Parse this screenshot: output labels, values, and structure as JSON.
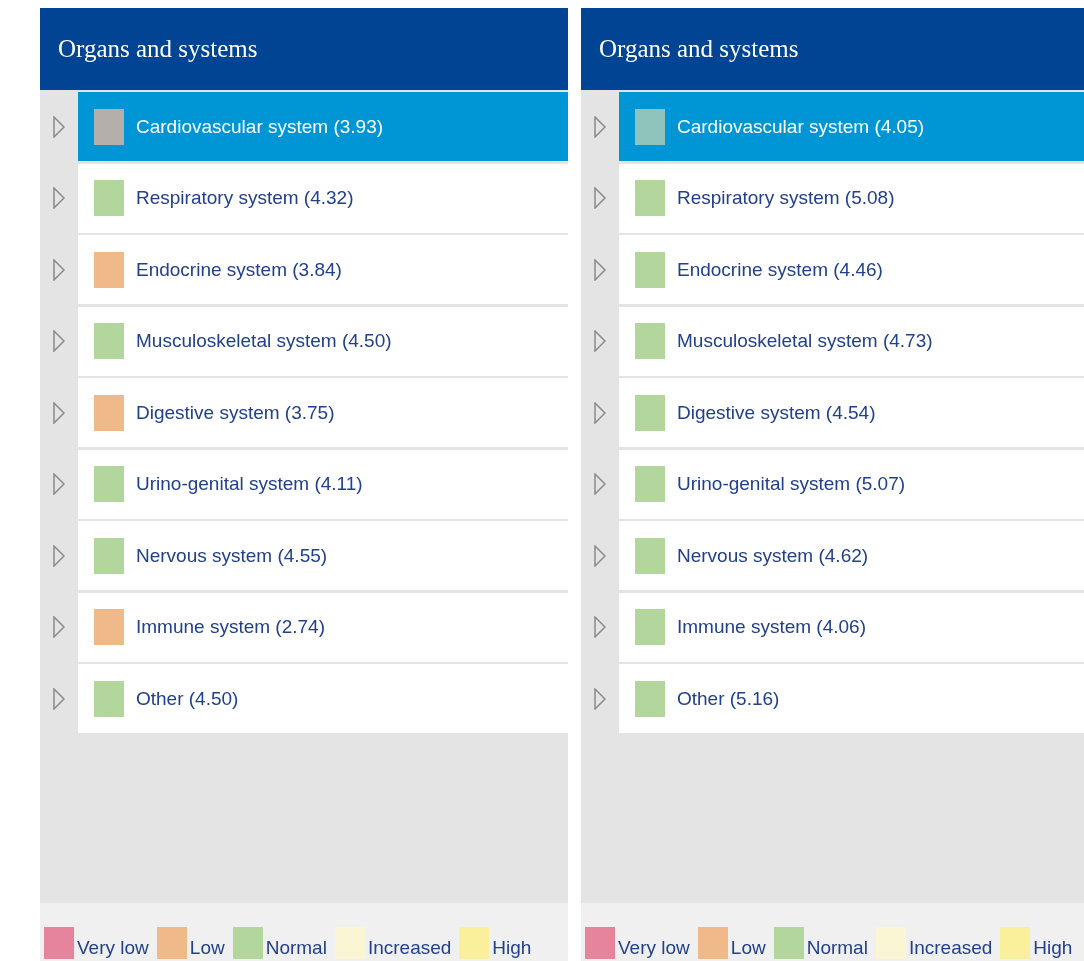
{
  "panels": [
    {
      "title": "Organs and systems",
      "items": [
        {
          "label": "Cardiovascular system (3.93)",
          "color": "#b5afab",
          "selected": true
        },
        {
          "label": "Respiratory system (4.32)",
          "color": "#b3d69d",
          "selected": false
        },
        {
          "label": "Endocrine system (3.84)",
          "color": "#f0b98a",
          "selected": false
        },
        {
          "label": "Musculoskeletal system (4.50)",
          "color": "#b3d69d",
          "selected": false
        },
        {
          "label": "Digestive system (3.75)",
          "color": "#f0b98a",
          "selected": false
        },
        {
          "label": "Urino-genital system (4.11)",
          "color": "#b3d69d",
          "selected": false
        },
        {
          "label": "Nervous system (4.55)",
          "color": "#b3d69d",
          "selected": false
        },
        {
          "label": "Immune system (2.74)",
          "color": "#f0b98a",
          "selected": false
        },
        {
          "label": "Other (4.50)",
          "color": "#b3d69d",
          "selected": false
        }
      ],
      "legend": [
        {
          "label": "Very low",
          "color": "#e6849c"
        },
        {
          "label": "Low",
          "color": "#f0b98a"
        },
        {
          "label": "Normal",
          "color": "#b3d69d"
        },
        {
          "label": "Increased",
          "color": "#faf5d3"
        },
        {
          "label": "High",
          "color": "#faf09c"
        }
      ]
    },
    {
      "title": "Organs and systems",
      "items": [
        {
          "label": "Cardiovascular system (4.05)",
          "color": "#8ec4bc",
          "selected": true
        },
        {
          "label": "Respiratory system (5.08)",
          "color": "#b3d69d",
          "selected": false
        },
        {
          "label": "Endocrine system (4.46)",
          "color": "#b3d69d",
          "selected": false
        },
        {
          "label": "Musculoskeletal system (4.73)",
          "color": "#b3d69d",
          "selected": false
        },
        {
          "label": "Digestive system (4.54)",
          "color": "#b3d69d",
          "selected": false
        },
        {
          "label": "Urino-genital system (5.07)",
          "color": "#b3d69d",
          "selected": false
        },
        {
          "label": "Nervous system (4.62)",
          "color": "#b3d69d",
          "selected": false
        },
        {
          "label": "Immune system (4.06)",
          "color": "#b3d69d",
          "selected": false
        },
        {
          "label": "Other (5.16)",
          "color": "#b3d69d",
          "selected": false
        }
      ],
      "legend": [
        {
          "label": "Very low",
          "color": "#e6849c"
        },
        {
          "label": "Low",
          "color": "#f0b98a"
        },
        {
          "label": "Normal",
          "color": "#b3d69d"
        },
        {
          "label": "Increased",
          "color": "#faf5d3"
        },
        {
          "label": "High",
          "color": "#faf09c"
        }
      ]
    }
  ]
}
